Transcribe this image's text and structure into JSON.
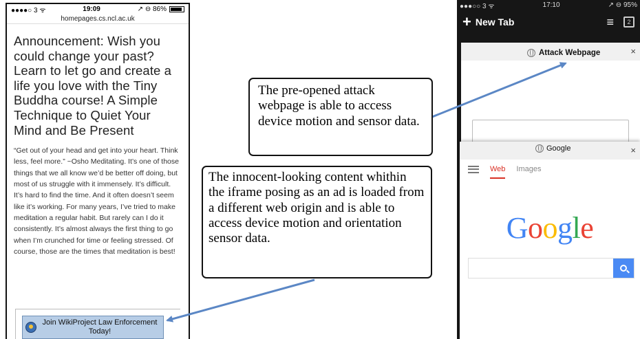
{
  "left_phone": {
    "status": {
      "carrier": "●●●●○ 3 ᯤ",
      "time": "19:09",
      "battery_text": "↗ ⊖ 86%",
      "battery_level": 0.86
    },
    "url": "homepages.cs.ncl.ac.uk",
    "article": {
      "heading": "Announcement: Wish you could change your past? Learn to let go and create a life you love with the Tiny Buddha course! A Simple Technique to Quiet Your Mind and Be Present",
      "body": "“Get out of your head and get into your heart. Think less, feel more.” ~Osho Meditating. It’s one of those things that we all know we’d be better off doing, but most of us struggle with it immensely. It’s difficult. It’s hard to find the time. And it often doesn’t seem like it’s working. For many years, I’ve tried to make meditation a regular habit. But rarely can I do it consistently. It’s almost always the first thing to go when I’m crunched for time or feeling stressed. Of course, those are the times that meditation is best!"
    },
    "ad": {
      "icon": "wikiproject-icon",
      "label": "Join WikiProject Law Enforcement Today!"
    }
  },
  "callouts": {
    "attack": "The pre-opened attack webpage is able to access device motion and sensor data.",
    "iframe": "The innocent-looking content whithin the iframe posing as an ad is loaded from a different web origin and is able to access device motion and orientation sensor data."
  },
  "right_phone": {
    "status": {
      "carrier": "●●●○○ 3 ᯤ",
      "time": "17:10",
      "battery_text": "↗ ⊖ 95%"
    },
    "toolbar": {
      "new_tab": "New Tab",
      "menu_icon": "menu-icon",
      "tab_count": "2"
    },
    "attack_tab": {
      "title": "Attack Webpage",
      "close": "×"
    },
    "google_tab": {
      "title": "Google",
      "close": "×",
      "nav_web": "Web",
      "nav_images": "Images",
      "logo": [
        "G",
        "o",
        "o",
        "g",
        "l",
        "e"
      ]
    }
  },
  "colors": {
    "arrow": "#5b87c5",
    "ad_bg": "#b7cde6",
    "google_blue": "#4285f4",
    "google_red": "#ea4335"
  }
}
